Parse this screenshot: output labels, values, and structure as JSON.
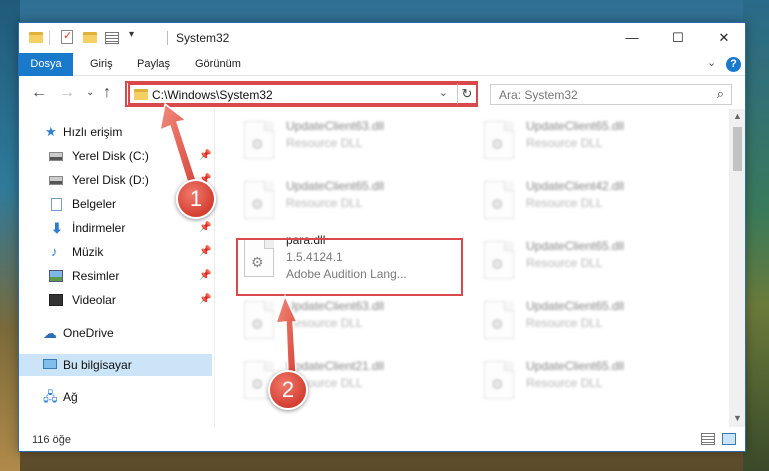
{
  "window": {
    "title": "System32",
    "controls": {
      "minimize": "—",
      "maximize": "☐",
      "close": "✕"
    }
  },
  "ribbon": {
    "tabs": [
      "Dosya",
      "Giriş",
      "Paylaş",
      "Görünüm"
    ],
    "expand_icon": "chevron-down-icon",
    "help_icon": "?"
  },
  "navigation": {
    "address_path": "C:\\Windows\\System32",
    "search_placeholder": "Ara: System32"
  },
  "sidebar": {
    "items": [
      {
        "label": "Hızlı erişim",
        "icon": "star-icon"
      },
      {
        "label": "Yerel Disk (C:)",
        "icon": "disk-icon",
        "pinned": true
      },
      {
        "label": "Yerel Disk (D:)",
        "icon": "disk-icon",
        "pinned": true
      },
      {
        "label": "Belgeler",
        "icon": "documents-icon",
        "pinned": true
      },
      {
        "label": "İndirmeler",
        "icon": "downloads-icon",
        "pinned": true
      },
      {
        "label": "Müzik",
        "icon": "music-icon",
        "pinned": true
      },
      {
        "label": "Resimler",
        "icon": "pictures-icon",
        "pinned": true
      },
      {
        "label": "Videolar",
        "icon": "videos-icon",
        "pinned": true
      },
      {
        "label": "OneDrive",
        "icon": "onedrive-icon"
      },
      {
        "label": "Bu bilgisayar",
        "icon": "computer-icon",
        "selected": true
      },
      {
        "label": "Ağ",
        "icon": "network-icon"
      }
    ]
  },
  "files": [
    {
      "name": "UpdateClient63.dll",
      "desc": "Resource DLL"
    },
    {
      "name": "UpdateClient65.dll",
      "desc": "Resource DLL"
    },
    {
      "name": "UpdateClient65.dll",
      "desc": "Resource DLL"
    },
    {
      "name": "UpdateClient42.dll",
      "desc": "Resource DLL"
    },
    {
      "name": "para.dll",
      "version": "1.5.4124.1",
      "desc": "Adobe Audition Lang..."
    },
    {
      "name": "UpdateClient65.dll",
      "desc": "Resource DLL"
    },
    {
      "name": "UpdateClient63.dll",
      "desc": "Resource DLL"
    },
    {
      "name": "UpdateClient65.dll",
      "desc": "Resource DLL"
    },
    {
      "name": "UpdateClient21.dll",
      "desc": "Resource DLL"
    },
    {
      "name": "UpdateClient65.dll",
      "desc": "Resource DLL"
    }
  ],
  "status": {
    "item_count": "116 öğe"
  },
  "annotations": {
    "step1": "1",
    "step2": "2",
    "color": "#d9494c"
  }
}
